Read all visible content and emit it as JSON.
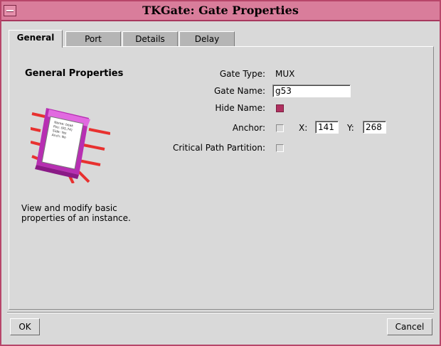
{
  "window": {
    "title": "TKGate: Gate Properties"
  },
  "tabs": [
    {
      "label": "General",
      "active": true
    },
    {
      "label": "Port",
      "active": false
    },
    {
      "label": "Details",
      "active": false
    },
    {
      "label": "Delay",
      "active": false
    }
  ],
  "general": {
    "heading": "General Properties",
    "description": "View and modify basic properties of an instance.",
    "icon": {
      "name": "gate-chip-icon",
      "text_lines": [
        "Name: beak",
        "Pos: (95,74)",
        "Side: Yes",
        "Anch: No"
      ]
    }
  },
  "form": {
    "gate_type_label": "Gate Type:",
    "gate_type_value": "MUX",
    "gate_name_label": "Gate Name:",
    "gate_name_value": "g53",
    "hide_name_label": "Hide Name:",
    "hide_name_checked": true,
    "anchor_label": "Anchor:",
    "anchor_checked": false,
    "x_label": "X:",
    "x_value": "141",
    "y_label": "Y:",
    "y_value": "268",
    "critical_path_label": "Critical Path Partition:",
    "critical_path_checked": false
  },
  "buttons": {
    "ok": "OK",
    "cancel": "Cancel"
  },
  "colors": {
    "titlebar": "#d97d9b",
    "accent": "#b03060",
    "background": "#d9d9d9"
  }
}
